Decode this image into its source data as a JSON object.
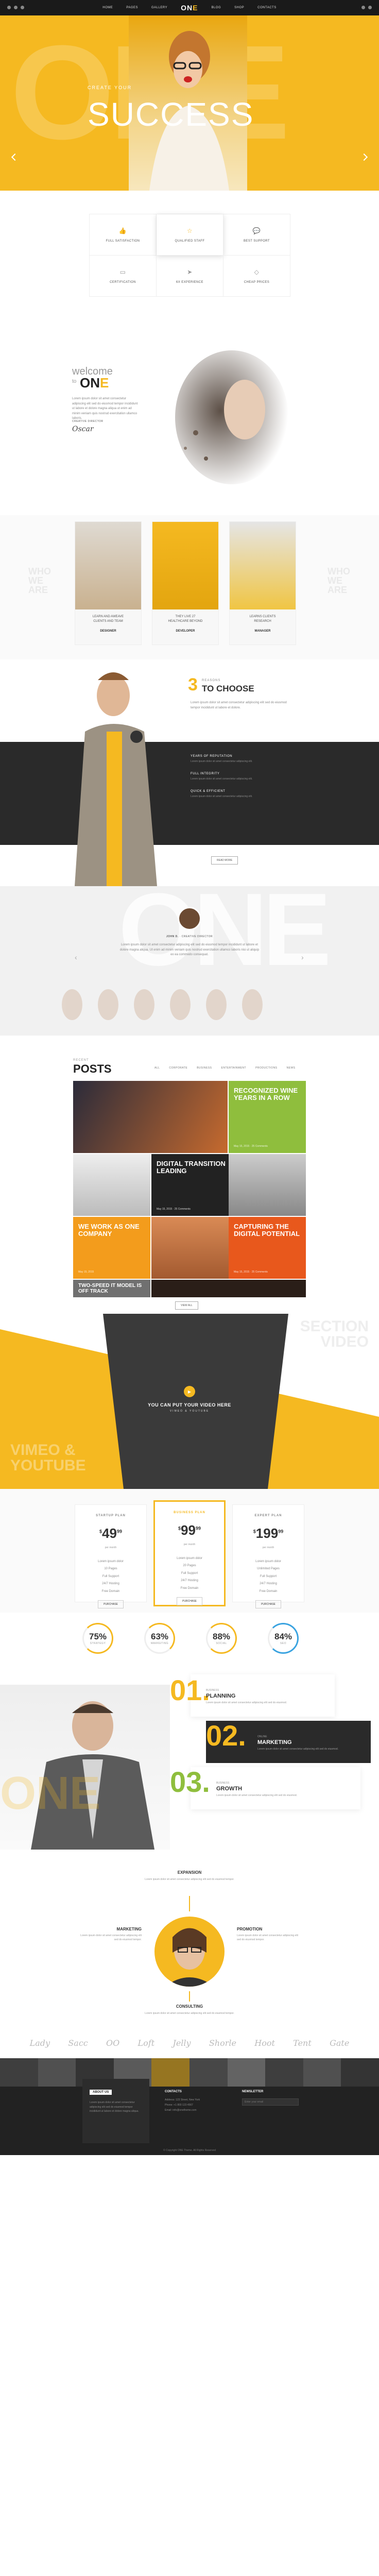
{
  "nav": {
    "items": [
      "HOME",
      "PAGES",
      "GALLERY",
      "BLOG",
      "SHOP",
      "CONTACTS"
    ],
    "logo_a": "ON",
    "logo_b": "E"
  },
  "hero": {
    "small": "CREATE YOUR",
    "title": "SUCCESS",
    "bg_word": "ONE"
  },
  "features": [
    {
      "icon": "thumb-up-icon",
      "label": "FULL SATISFACTION"
    },
    {
      "icon": "star-icon",
      "label": "QUALIFIED STAFF"
    },
    {
      "icon": "chat-icon",
      "label": "BEST SUPPORT"
    },
    {
      "icon": "certificate-icon",
      "label": "CERTIFICATION"
    },
    {
      "icon": "paper-plane-icon",
      "label": "6X EXPERIENCE"
    },
    {
      "icon": "diamond-icon",
      "label": "CHEAP PRICES"
    }
  ],
  "welcome": {
    "pre": "welcome",
    "to": "to",
    "name_a": "ON",
    "name_b": "E",
    "text": "Lorem ipsum dolor sit amet consectetur adipiscing elit sed do eiusmod tempor incididunt ut labore et dolore magna aliqua ut enim ad minim veniam quis nostrud exercitation ullamco laboris.",
    "sign_label": "CREATIVE DIRECTOR",
    "signature": "Oscar"
  },
  "team": {
    "side_l": "WHO WE ARE",
    "side_r": "WHO WE ARE",
    "members": [
      {
        "text": "LEARN AND AWEAVE\nCLIENTS AND TEAM",
        "role": "DESIGNER"
      },
      {
        "text": "THEY LIVE 27\nHEALTHCARE BEYOND",
        "role": "DEVELOPER"
      },
      {
        "text": "LEARNS CLIENTS\nRESEARCH",
        "role": "MANAGER"
      }
    ]
  },
  "choose": {
    "num": "3",
    "reasons": "REASONS",
    "title": "TO CHOOSE",
    "text": "Lorem ipsum dolor sit amet consectetur adipiscing elit sed do eiusmod tempor incididunt ut labore et dolore.",
    "items": [
      {
        "title": "YEARS OF REPUTATION",
        "text": "Lorem ipsum dolor sit amet consectetur adipiscing elit."
      },
      {
        "title": "FULL INTEGRITY",
        "text": "Lorem ipsum dolor sit amet consectetur adipiscing elit."
      },
      {
        "title": "QUICK & EFFICIENT",
        "text": "Lorem ipsum dolor sit amet consectetur adipiscing elit."
      }
    ],
    "button": "READ MORE"
  },
  "testimonial": {
    "bg_word": "ONE",
    "name": "JOHN D.",
    "role": "CREATIVE DIRECTOR",
    "text": "Lorem ipsum dolor sit amet consectetur adipiscing elit sed do eiusmod tempor incididunt ut labore et dolore magna aliqua. Ut enim ad minim veniam quis nostrud exercitation ullamco laboris nisi ut aliquip ex ea commodo consequat."
  },
  "posts": {
    "pre": "RECENT",
    "title": "POSTS",
    "filters": [
      "ALL",
      "CORPORATE",
      "BUSINESS",
      "ENTERTAINMENT",
      "PRODUCTIONS",
      "NEWS"
    ],
    "tiles": [
      {
        "title": "RECOGNIZED WINE YEARS IN A ROW",
        "meta": "May 15, 2015 · 25 Comments"
      },
      {
        "title": "DIGITAL TRANSITION LEADING",
        "meta": "May 15, 2015 · 25 Comments"
      },
      {
        "title": "WE WORK AS ONE COMPANY",
        "meta": "May 15, 2015"
      },
      {
        "title": "CAPTURING THE DIGITAL POTENTIAL",
        "meta": "May 15, 2015 · 25 Comments"
      },
      {
        "title": "TWO-SPEED IT MODEL IS OFF TRACK",
        "meta": "May 15, 2015 · 25 Comments"
      }
    ],
    "button": "VIEW ALL"
  },
  "video": {
    "title": "YOU CAN PUT YOUR VIDEO HERE",
    "sub": "VIMEO & YOUTUBE",
    "bg_r": "SECTION VIDEO",
    "bg_l": "VIMEO & YOUTUBE"
  },
  "pricing": [
    {
      "name": "STARTUP PLAN",
      "price": "49",
      "cents": "99",
      "period": "per month",
      "items": [
        "Lorem ipsum dolor",
        "10 Pages",
        "Full Support",
        "24/7 Hosting",
        "Free Domain"
      ],
      "btn": "PURCHASE"
    },
    {
      "name": "BUSINESS PLAN",
      "price": "99",
      "cents": "99",
      "period": "per month",
      "items": [
        "Lorem ipsum dolor",
        "20 Pages",
        "Full Support",
        "24/7 Hosting",
        "Free Domain"
      ],
      "btn": "PURCHASE"
    },
    {
      "name": "EXPERT PLAN",
      "price": "199",
      "cents": "99",
      "period": "per month",
      "items": [
        "Lorem ipsum dolor",
        "Unlimited Pages",
        "Full Support",
        "24/7 Hosting",
        "Free Domain"
      ],
      "btn": "PURCHASE"
    }
  ],
  "counters": [
    {
      "value": "75%",
      "label": "STRATEGY",
      "pct": 0.75
    },
    {
      "value": "63%",
      "label": "MARKETING",
      "pct": 0.63
    },
    {
      "value": "88%",
      "label": "SOCIAL",
      "pct": 0.88
    },
    {
      "value": "84%",
      "label": "SEO",
      "pct": 0.84
    }
  ],
  "steps": [
    {
      "num": "01.",
      "label": "BUSINESS",
      "title": "PLANNING",
      "text": "Lorem ipsum dolor sit amet consectetur adipiscing elit sed do eiusmod."
    },
    {
      "num": "02.",
      "label": "ONLINE",
      "title": "MARKETING",
      "text": "Lorem ipsum dolor sit amet consectetur adipiscing elit sed do eiusmod."
    },
    {
      "num": "03.",
      "label": "BUSINESS",
      "title": "GROWTH",
      "text": "Lorem ipsum dolor sit amet consectetur adipiscing elit sed do eiusmod."
    }
  ],
  "services": {
    "top": "EXPANSION",
    "left": "MARKETING",
    "right": "PROMOTION",
    "bottom": "CONSULTING",
    "text": "Lorem ipsum dolor sit amet consectetur adipiscing elit sed do eiusmod tempor."
  },
  "clients": [
    "Lady",
    "Sacc",
    "OO",
    "Loft",
    "Jelly",
    "Shorle",
    "Hoot",
    "Tent",
    "Gate"
  ],
  "footer": {
    "col1": "ABOUT US",
    "col2": "CONTACTS",
    "col3": "NEWSLETTER",
    "about": "Lorem ipsum dolor sit amet consectetur adipiscing elit sed do eiusmod tempor incididunt ut labore et dolore magna aliqua.",
    "contacts": [
      "Address: 123 Street, New York",
      "Phone: +1 800 123 4567",
      "Email: info@onetheme.com"
    ],
    "news_ph": "Enter your email",
    "copyright": "© Copyright ONE Theme. All Rights Reserved"
  },
  "colors": {
    "accent": "#f5b921",
    "dark": "#2a2a2a"
  }
}
